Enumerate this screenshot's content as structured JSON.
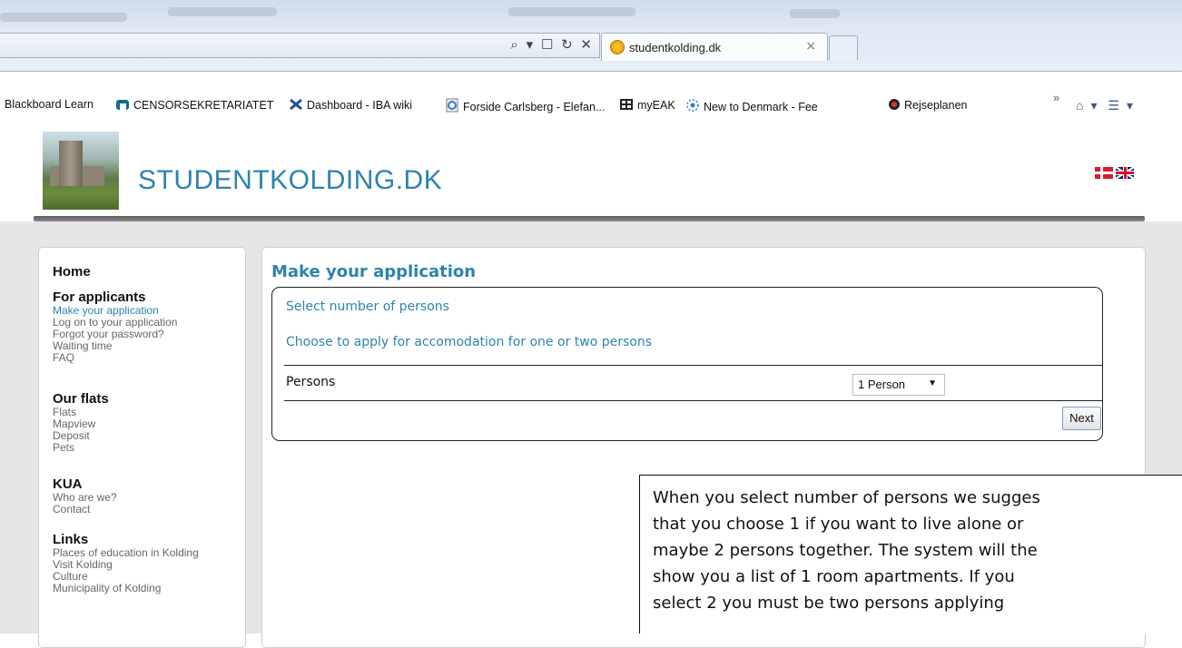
{
  "browser": {
    "tab_title": "studentkolding.dk",
    "tab_close": "×",
    "url_controls": "⌕ ▾ ☐ ↻ ✕",
    "favorites": [
      {
        "label": "Blackboard Learn",
        "icon": "none"
      },
      {
        "label": "CENSORSEKRETARIATET",
        "icon": "censor-icon"
      },
      {
        "label": "Dashboard - IBA wiki",
        "icon": "tools-icon"
      },
      {
        "label": "Forside Carlsberg - Elefan...",
        "icon": "ie-page-icon"
      },
      {
        "label": "myEAK",
        "icon": "grid-icon"
      },
      {
        "label": "New to Denmark - Fee",
        "icon": "feed-icon"
      },
      {
        "label": "Rejseplanen",
        "icon": "target-icon"
      }
    ],
    "chevron": "»",
    "tools": {
      "home": "⌂",
      "home_dropdown": "▾",
      "feeds": "☰",
      "feeds_dropdown": "▾"
    }
  },
  "site": {
    "title": "STUDENTKOLDING.DK",
    "flag_dk": "Danish flag",
    "flag_uk": "English flag"
  },
  "sidebar": {
    "home": "Home",
    "sections": [
      {
        "heading": "For applicants",
        "links": [
          "Make your application",
          "Log on to your application",
          "Forgot your password?",
          "Waiting time",
          "FAQ"
        ]
      },
      {
        "heading": "Our flats",
        "links": [
          "Flats",
          "Mapview",
          "Deposit",
          "Pets"
        ]
      },
      {
        "heading": "KUA",
        "links": [
          "Who are we?",
          "Contact"
        ]
      },
      {
        "heading": "Links",
        "links": [
          "Places of education in Kolding",
          "Visit Kolding",
          "Culture",
          "Municipality of Kolding"
        ]
      }
    ]
  },
  "main": {
    "title": "Make your application",
    "step_title": "Select number of persons",
    "step_desc": "Choose to apply for accomodation for one or two persons",
    "persons_label": "Persons",
    "persons_value": "1 Person",
    "select_arrow": "▼",
    "next_label": "Next"
  },
  "callout": {
    "lines": [
      "When you select number of persons we sugges",
      "that you choose 1 if you want to live alone or",
      "maybe 2 persons together. The system will the",
      "show you a list of 1 room apartments. If you",
      "select 2 you must be two persons applying"
    ]
  },
  "colors": {
    "accent": "#2d83ae",
    "header_rule": "#6b6b6b",
    "page_bg": "#e6e6e6"
  }
}
